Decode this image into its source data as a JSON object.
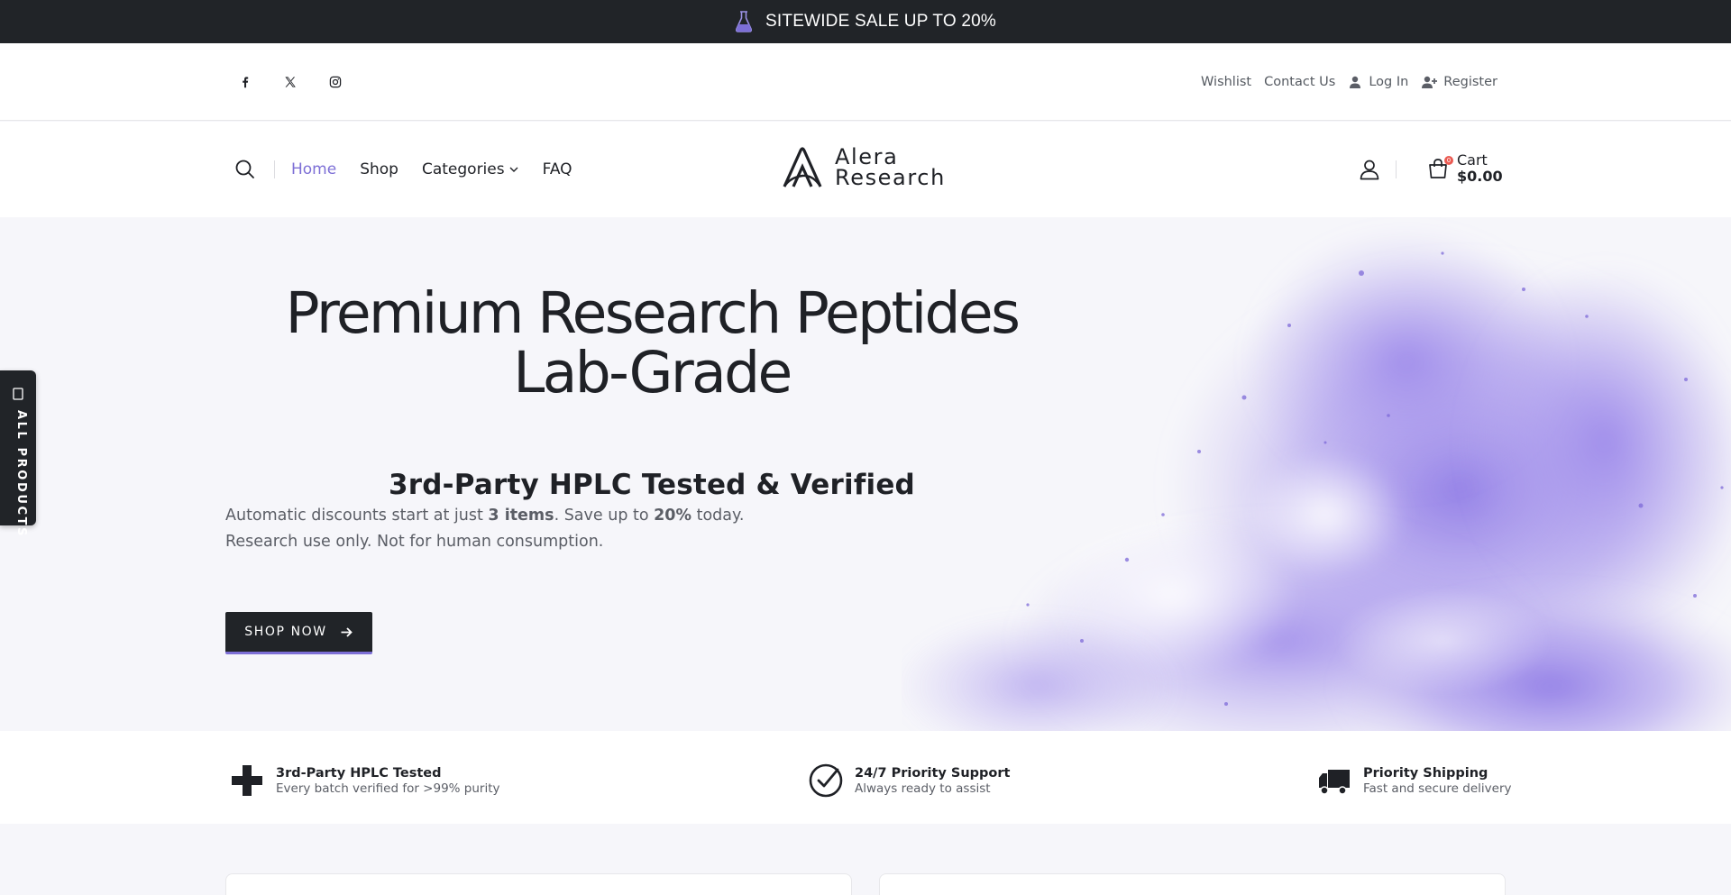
{
  "announcement": {
    "text": "SITEWIDE SALE UP TO 20%",
    "icon": "flask-icon"
  },
  "social": [
    {
      "name": "facebook",
      "icon": "facebook-icon"
    },
    {
      "name": "x",
      "icon": "x-icon"
    },
    {
      "name": "instagram",
      "icon": "instagram-icon"
    }
  ],
  "utility_links": {
    "wishlist": "Wishlist",
    "contact": "Contact Us",
    "login": "Log In",
    "register": "Register"
  },
  "nav": {
    "items": [
      "Home",
      "Shop",
      "Categories",
      "FAQ"
    ],
    "active": "Home"
  },
  "logo": {
    "line1": "Alera",
    "line2": "Research"
  },
  "cart": {
    "label": "Cart",
    "total": "$0.00",
    "count": "0"
  },
  "hero": {
    "title_line1": "Premium Research Peptides",
    "title_line2": "Lab-Grade",
    "subtitle": "3rd-Party HPLC Tested & Verified",
    "desc_pre": "Automatic discounts start at just ",
    "desc_items": "3 items",
    "desc_mid": ". Save up to ",
    "desc_pct": "20%",
    "desc_post": " today.",
    "disclaimer": "Research use only. Not for human consumption.",
    "cta": "SHOP NOW"
  },
  "side_tab": {
    "label": "ALL PRODUCTS"
  },
  "features": [
    {
      "title": "3rd-Party HPLC Tested",
      "subtitle": "Every batch verified for >99% purity",
      "icon": "plus-icon"
    },
    {
      "title": "24/7 Priority Support",
      "subtitle": "Always ready to assist",
      "icon": "check-circle-icon"
    },
    {
      "title": "Priority Shipping",
      "subtitle": "Fast and secure delivery",
      "icon": "truck-icon"
    }
  ],
  "colors": {
    "accent": "#7d6fd6",
    "dark": "#212428",
    "badge": "#ea5a52",
    "hero_bg": "#f6f6fa"
  }
}
